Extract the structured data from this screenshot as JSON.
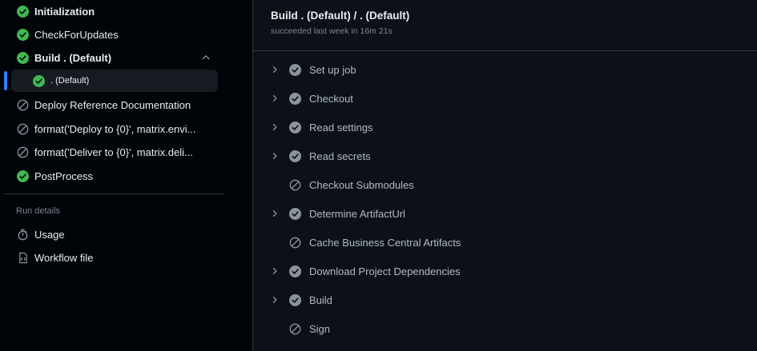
{
  "sidebar": {
    "jobs": [
      {
        "label": "Initialization",
        "status": "success"
      },
      {
        "label": "CheckForUpdates",
        "status": "success"
      },
      {
        "label": "Build . (Default)",
        "status": "success"
      },
      {
        "label": ". (Default)",
        "status": "success"
      },
      {
        "label": "Deploy Reference Documentation",
        "status": "skipped"
      },
      {
        "label": "format('Deploy to {0}', matrix.envi...",
        "status": "skipped"
      },
      {
        "label": "format('Deliver to {0}', matrix.deli...",
        "status": "skipped"
      },
      {
        "label": "PostProcess",
        "status": "success"
      }
    ],
    "run_details_label": "Run details",
    "links": [
      {
        "label": "Usage",
        "icon": "stopwatch-icon"
      },
      {
        "label": "Workflow file",
        "icon": "file-code-icon"
      }
    ]
  },
  "main": {
    "title": "Build . (Default) / . (Default)",
    "subtitle": "succeeded last week in 16m 21s",
    "steps": [
      {
        "label": "Set up job",
        "status": "success",
        "expandable": true
      },
      {
        "label": "Checkout",
        "status": "success",
        "expandable": true
      },
      {
        "label": "Read settings",
        "status": "success",
        "expandable": true
      },
      {
        "label": "Read secrets",
        "status": "success",
        "expandable": true
      },
      {
        "label": "Checkout Submodules",
        "status": "skipped",
        "expandable": false
      },
      {
        "label": "Determine ArtifactUrl",
        "status": "success",
        "expandable": true
      },
      {
        "label": "Cache Business Central Artifacts",
        "status": "skipped",
        "expandable": false
      },
      {
        "label": "Download Project Dependencies",
        "status": "success",
        "expandable": true
      },
      {
        "label": "Build",
        "status": "success",
        "expandable": true
      },
      {
        "label": "Sign",
        "status": "skipped",
        "expandable": false
      }
    ]
  },
  "colors": {
    "success": "#3fb950",
    "step_success": "#8b949e",
    "skipped": "#8b949e",
    "accent": "#2f81f7"
  }
}
